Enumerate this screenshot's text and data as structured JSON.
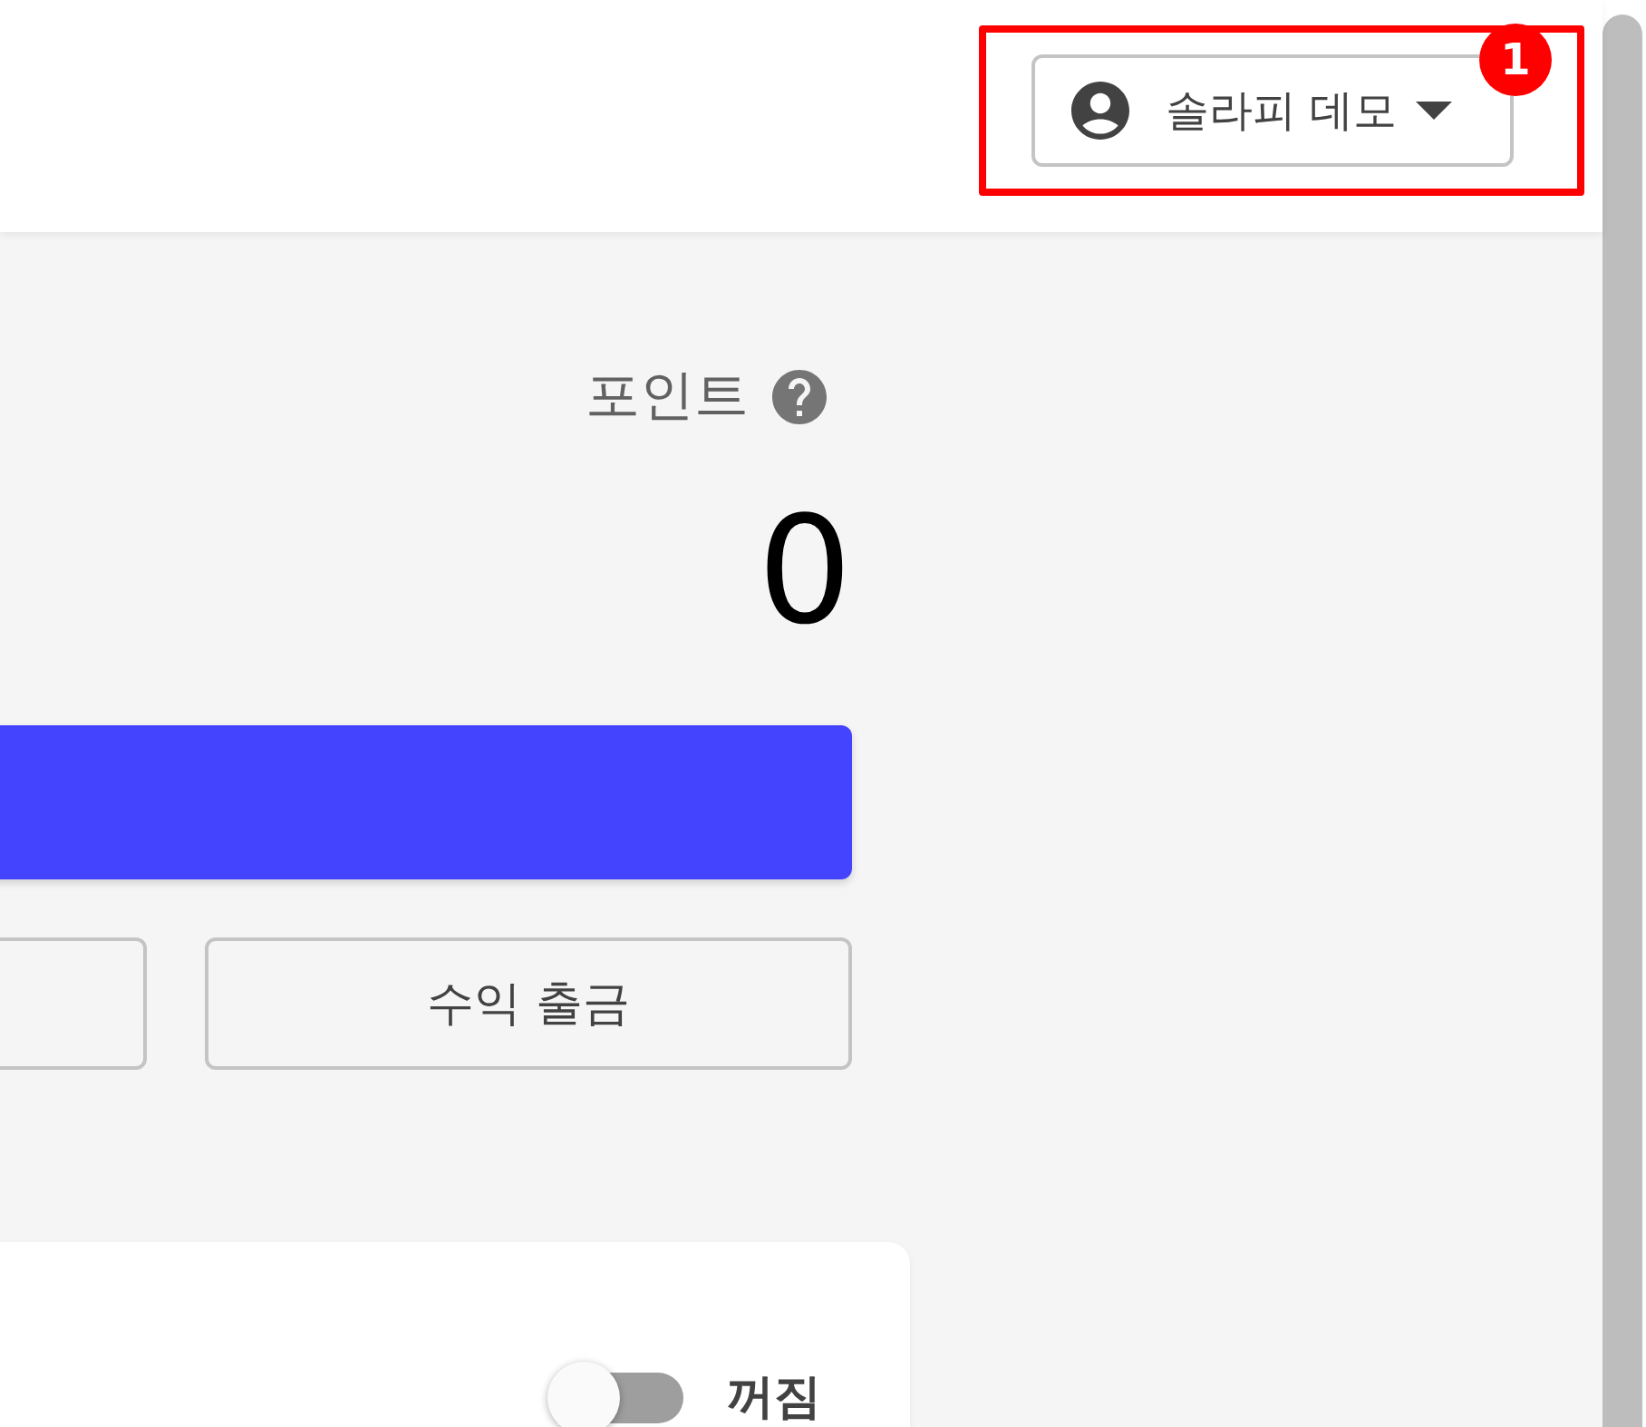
{
  "user_menu": {
    "name": "솔라피 데모"
  },
  "annotation": {
    "number": "1"
  },
  "points": {
    "label": "포인트",
    "value": "0"
  },
  "withdraw_button": {
    "label": "수익 출금"
  },
  "card": {
    "toggle": {
      "on": false,
      "label": "꺼짐"
    }
  }
}
